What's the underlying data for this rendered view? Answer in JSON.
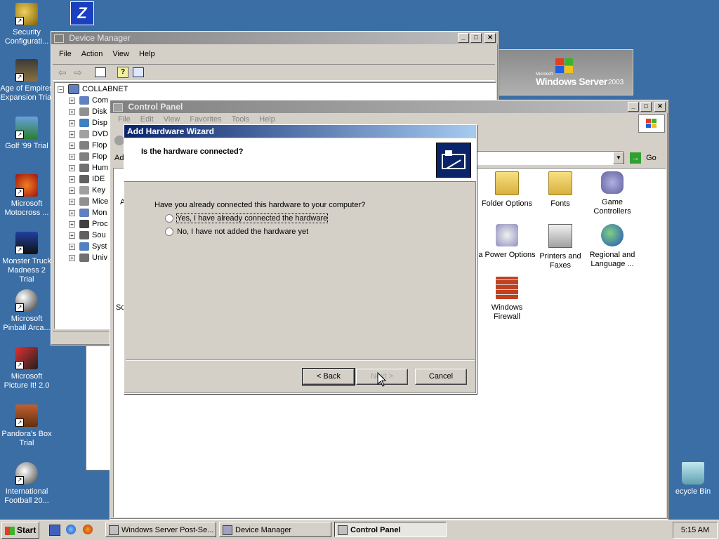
{
  "desktop": {
    "icons": [
      {
        "label": "Security Configurati...",
        "icon": "security-config-icon"
      },
      {
        "label": "Age of Empires Expansion Trial",
        "icon": "age-of-empires-icon"
      },
      {
        "label": "Golf '99 Trial",
        "icon": "golf-icon"
      },
      {
        "label": "Microsoft Motocross ...",
        "icon": "motocross-icon"
      },
      {
        "label": "Monster Truck Madness 2 Trial",
        "icon": "monster-truck-icon"
      },
      {
        "label": "Microsoft Pinball Arca...",
        "icon": "pinball-icon"
      },
      {
        "label": "Microsoft Picture It! 2.0",
        "icon": "picture-it-icon"
      },
      {
        "label": "Pandora's Box Trial",
        "icon": "pandoras-box-icon"
      },
      {
        "label": "International Football 20...",
        "icon": "football-icon"
      },
      {
        "label": "ecycle Bin",
        "icon": "recycle-bin-icon"
      }
    ]
  },
  "banner": {
    "text1": "Windows Server",
    "text2": "2003",
    "small": "Microsoft"
  },
  "device_manager": {
    "title": "Device Manager",
    "menu": [
      "File",
      "Action",
      "View",
      "Help"
    ],
    "root": "COLLABNET",
    "items": [
      "Com",
      "Disk",
      "Disp",
      "DVD",
      "Flop",
      "Flop",
      "Hum",
      "IDE",
      "Key",
      "Mice",
      "Mon",
      "Proc",
      "Sou",
      "Syst",
      "Univ"
    ]
  },
  "control_panel": {
    "title": "Control Panel",
    "menu": [
      "File",
      "Edit",
      "View",
      "Favorites",
      "Tools",
      "Help"
    ],
    "address_label": "Ad",
    "go_label": "Go",
    "left_partial_a": "A",
    "left_partial_sc": "Sc",
    "icons": [
      {
        "label": "Folder Options",
        "icon": "folder-options-icon"
      },
      {
        "label": "Fonts",
        "icon": "fonts-icon"
      },
      {
        "label": "Game Controllers",
        "icon": "game-controllers-icon"
      },
      {
        "label": "a Power Options",
        "icon": "power-options-icon"
      },
      {
        "label": "Printers and Faxes",
        "icon": "printers-faxes-icon"
      },
      {
        "label": "Regional and Language ...",
        "icon": "regional-language-icon"
      },
      {
        "label": "Windows Firewall",
        "icon": "windows-firewall-icon"
      }
    ]
  },
  "wizard": {
    "title": "Add Hardware Wizard",
    "heading": "Is the hardware connected?",
    "question": "Have you already connected this hardware to your computer?",
    "option_yes": "Yes, I have already connected the hardware",
    "option_no": "No, I have not added the hardware yet",
    "back": "< Back",
    "next": "Next >",
    "cancel": "Cancel"
  },
  "taskbar": {
    "start": "Start",
    "tasks": [
      "Windows Server Post-Se...",
      "Device Manager",
      "Control Panel"
    ],
    "clock": "5:15 AM"
  }
}
